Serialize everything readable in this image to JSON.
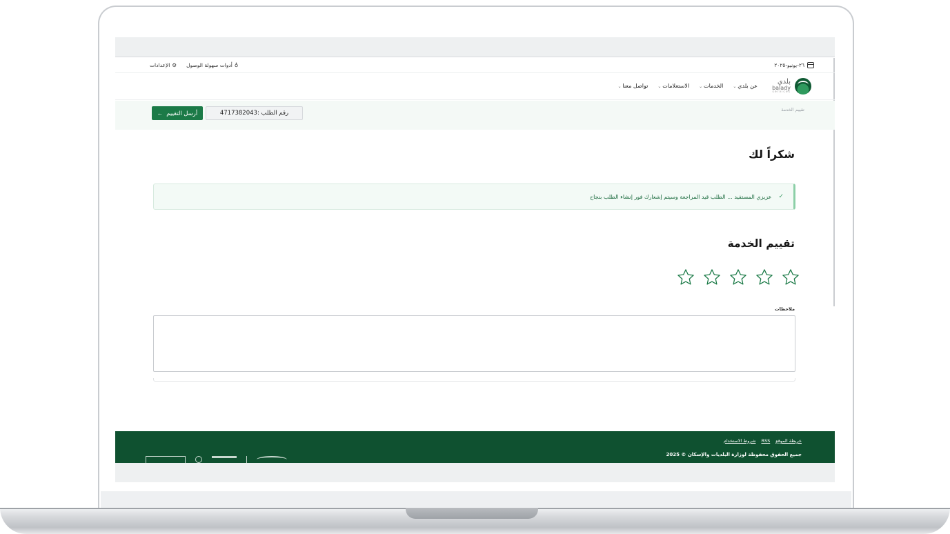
{
  "topbar": {
    "date": "٢٦-يونيو-٢٠٢٥",
    "settings": "الإعدادات",
    "accessibility": "أدوات سهولة الوصول"
  },
  "logo": {
    "ar": "بلدي",
    "en": "balady",
    "en_sub": "services"
  },
  "nav": {
    "items": [
      "عن بلدي",
      "الخدمات",
      "الاستعلامات",
      "تواصل معنا"
    ]
  },
  "band": {
    "breadcrumb": "تقييم الخدمة",
    "order_label": "رقم الطلب :4717382043",
    "send_button": "أرسل التقييم"
  },
  "main": {
    "thanks_title": "شكراً لك",
    "alert_text": "عزيزي المستفيد ... الطلب قيد المراجعة وسيتم إشعارك فور إنشاء الطلب بنجاح",
    "rating_title": "تقييم الخدمة",
    "rating_value": 0,
    "rating_max": 5,
    "notes_label": "ملاحظات"
  },
  "footer": {
    "links": [
      "خريطة الموقع",
      "RSS",
      "شروط الاستخدام"
    ],
    "copyright": "جميع الحقوق محفوظة لوزارة البلديات والإسكان © 2025"
  },
  "colors": {
    "brand_green": "#1b7a47",
    "footer_green": "#0f5130",
    "band_bg": "#f4f9f6"
  }
}
